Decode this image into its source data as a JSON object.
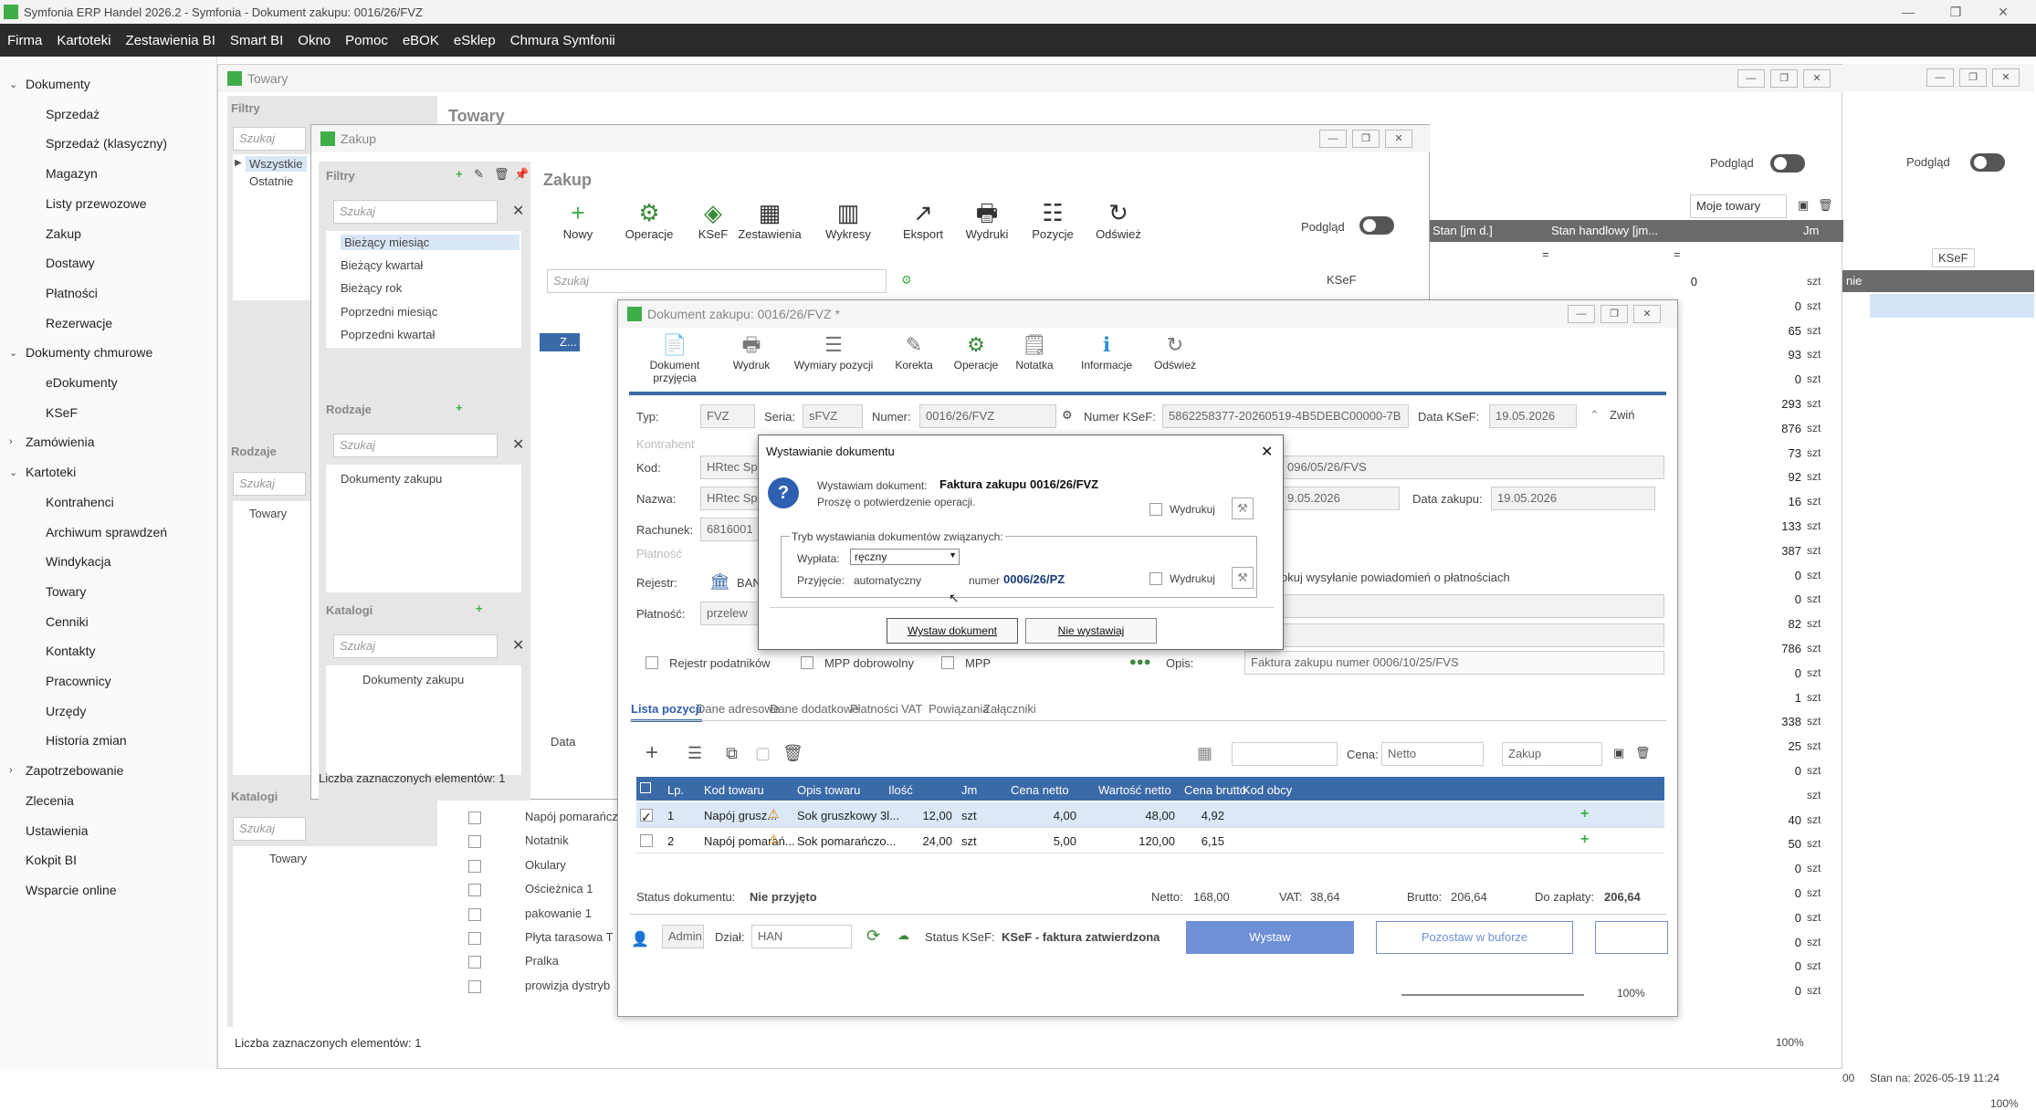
{
  "app": {
    "title": "Symfonia ERP Handel 2026.2 - Symfonia - Dokument zakupu: 0016/26/FVZ"
  },
  "menu": [
    "Firma",
    "Kartoteki",
    "Zestawienia BI",
    "Smart BI",
    "Okno",
    "Pomoc",
    "eBOK",
    "eSklep",
    "Chmura Symfonii"
  ],
  "sidebar": [
    {
      "label": "Dokumenty",
      "level": 0,
      "expanded": true
    },
    {
      "label": "Sprzedaż",
      "level": 1
    },
    {
      "label": "Sprzedaż (klasyczny)",
      "level": 1
    },
    {
      "label": "Magazyn",
      "level": 1
    },
    {
      "label": "Listy przewozowe",
      "level": 1
    },
    {
      "label": "Zakup",
      "level": 1
    },
    {
      "label": "Dostawy",
      "level": 1
    },
    {
      "label": "Płatności",
      "level": 1
    },
    {
      "label": "Rezerwacje",
      "level": 1
    },
    {
      "label": "Dokumenty chmurowe",
      "level": 0,
      "expanded": true
    },
    {
      "label": "eDokumenty",
      "level": 1
    },
    {
      "label": "KSeF",
      "level": 1
    },
    {
      "label": "Zamówienia",
      "level": 0,
      "expanded": false
    },
    {
      "label": "Kartoteki",
      "level": 0,
      "expanded": true
    },
    {
      "label": "Kontrahenci",
      "level": 1
    },
    {
      "label": "Archiwum sprawdzeń",
      "level": 1
    },
    {
      "label": "Windykacja",
      "level": 1
    },
    {
      "label": "Towary",
      "level": 1
    },
    {
      "label": "Cenniki",
      "level": 1
    },
    {
      "label": "Kontakty",
      "level": 1
    },
    {
      "label": "Pracownicy",
      "level": 1
    },
    {
      "label": "Urzędy",
      "level": 1
    },
    {
      "label": "Historia zmian",
      "level": 1
    },
    {
      "label": "Zapotrzebowanie",
      "level": 0,
      "expanded": false
    },
    {
      "label": "Zlecenia",
      "level": 0
    },
    {
      "label": "Ustawienia",
      "level": 0
    },
    {
      "label": "Kokpit BI",
      "level": 0
    },
    {
      "label": "Wsparcie online",
      "level": 0
    }
  ],
  "towary_window": {
    "title": "Towary",
    "heading": "Towary",
    "filters_label": "Filtry",
    "search_placeholder": "Szukaj",
    "filters": [
      "Wszystkie",
      "Ostatnie"
    ],
    "rodzaje_label": "Rodzaje",
    "rodzaje_items": [
      "Towary"
    ],
    "katalogi_label": "Katalogi",
    "katalogi_items": [
      "Towary"
    ],
    "preview_label": "Podgląd",
    "view_select": "Moje towary",
    "col_stan": "Stan [jm d.]",
    "col_handlowy": "Stan handlowy [jm...",
    "col_jm": "Jm",
    "eq": "=",
    "stan_first": "0",
    "stan_handlowy": [
      "0",
      "65",
      "93",
      "0",
      "293",
      "876",
      "73",
      "92",
      "16",
      "133",
      "387",
      "0",
      "0",
      "82",
      "786",
      "0",
      "1",
      "338",
      "25",
      "0",
      "",
      "40",
      "50",
      "0",
      "0",
      "0",
      "0",
      "0",
      "0"
    ],
    "unit": "szt",
    "products": [
      "Napój pomarańcz",
      "Notatnik",
      "Okulary",
      "Ościeżnica 1",
      "pakowanie 1",
      "Płyta tarasowa T",
      "Pralka",
      "prowizja dystryb"
    ],
    "status_count": "Liczba zaznaczonych elementów: 1",
    "zoom": "100%"
  },
  "right_window": {
    "preview_label": "Podgląd",
    "ksef": "KSeF",
    "col": "nie",
    "status": "Stan na: 2026-05-19 11:24",
    "pre": "00",
    "zoom": "100%"
  },
  "zakup_window": {
    "title": "Zakup",
    "heading": "Zakup",
    "filters_label": "Filtry",
    "search_placeholder": "Szukaj",
    "filters": [
      "Bieżący miesiąc",
      "Bieżący kwartał",
      "Bieżący rok",
      "Poprzedni miesiąc",
      "Poprzedni kwartał"
    ],
    "rodzaje_label": "Rodzaje",
    "rodzaje_items": [
      "Dokumenty zakupu"
    ],
    "katalogi_label": "Katalogi",
    "katalogi_items": [
      "Dokumenty zakupu"
    ],
    "toolbar": [
      "Nowy",
      "Operacje",
      "KSeF",
      "Zestawienia",
      "Wykresy",
      "Eksport",
      "Wydruki",
      "Pozycje",
      "Odśwież"
    ],
    "preview_label": "Podgląd",
    "ksef": "KSeF",
    "col_z": "Z...",
    "data_label": "Data",
    "status_count": "Liczba zaznaczonych elementów: 1"
  },
  "doc_window": {
    "title": "Dokument zakupu: 0016/26/FVZ *",
    "toolbar": [
      "Dokument przyjęcia",
      "Wydruk",
      "Wymiary pozycji",
      "Korekta",
      "Operacje",
      "Notatka",
      "Informacje",
      "Odśwież"
    ],
    "typ_label": "Typ:",
    "typ": "FVZ",
    "seria_label": "Seria:",
    "seria": "sFVZ",
    "numer_label": "Numer:",
    "numer": "0016/26/FVZ",
    "numer_ksef_label": "Numer KSeF:",
    "numer_ksef": "5862258377-20260519-4B5DEBC00000-7B",
    "data_ksef_label": "Data KSeF:",
    "data_ksef": "19.05.2026",
    "zwin": "Zwiń",
    "kontrahent_label": "Kontrahent",
    "kod_label": "Kod:",
    "kod": "HRtec Sp",
    "nazwa_label": "Nazwa:",
    "nazwa": "HRtec Sp",
    "rachunek_label": "Rachunek:",
    "rachunek": "6816001",
    "platnosc_section": "Płatność",
    "rejestr_label": "Rejestr:",
    "rejestr": "BAN",
    "platnosc_label": "Płatność:",
    "platnosc": "przelew",
    "doc_obcy": "096/05/26/FVS",
    "data_wyst": "9.05.2026",
    "data_zakupu_label": "Data zakupu:",
    "data_zakupu": "19.05.2026",
    "powiadomienia": "okuj wysyłanie powiadomień o płatnościach",
    "rejestr_podatnikow": "Rejestr podatników",
    "mpp_dobrowolny": "MPP dobrowolny",
    "mpp": "MPP",
    "opis_label": "Opis:",
    "opis": "Faktura zakupu numer 0006/10/25/FVS",
    "tabs": [
      "Lista pozycji",
      "Dane adresowe",
      "Dane dodatkowe",
      "Płatności",
      "VAT",
      "Powiązania",
      "Załączniki"
    ],
    "cena_label": "Cena:",
    "cena": "Netto",
    "cena_typ": "Zakup",
    "columns": [
      "Lp.",
      "Kod towaru",
      "Opis towaru",
      "Ilość",
      "Jm",
      "Cena netto",
      "Wartość netto",
      "Cena brutto",
      "Kod obcy"
    ],
    "rows": [
      {
        "lp": "1",
        "kod": "Napój grusz...",
        "opis": "Sok gruszkowy 3l...",
        "ilosc": "12,00",
        "jm": "szt",
        "cena_netto": "4,00",
        "wartosc": "48,00",
        "brutto": "4,92"
      },
      {
        "lp": "2",
        "kod": "Napój pomarań...",
        "opis": "Sok pomarańczo...",
        "ilosc": "24,00",
        "jm": "szt",
        "cena_netto": "5,00",
        "wartosc": "120,00",
        "brutto": "6,15"
      }
    ],
    "status_label": "Status dokumentu:",
    "status": "Nie przyjęto",
    "netto_label": "Netto:",
    "netto": "168,00",
    "vat_label": "VAT:",
    "vat": "38,64",
    "brutto_label": "Brutto:",
    "brutto": "206,64",
    "zaplaty_label": "Do zapłaty:",
    "zaplaty": "206,64",
    "user": "Admin",
    "dzial_label": "Dział:",
    "dzial": "HAN",
    "ksef_status_label": "Status KSeF:",
    "ksef_status": "KSeF - faktura zatwierdzona",
    "wystaw": "Wystaw",
    "pozostaw": "Pozostaw w buforze",
    "zoom": "100%"
  },
  "dialog": {
    "title": "Wystawianie dokumentu",
    "issuing": "Wystawiam dokument:",
    "doc": "Faktura zakupu 0016/26/FVZ",
    "confirm": "Proszę o potwierdzenie operacji.",
    "wydrukuj": "Wydrukuj",
    "group": "Tryb wystawiania dokumentów związanych:",
    "wyplata_label": "Wypłata:",
    "wyplata": "ręczny",
    "przyjecie_label": "Przyjęcie:",
    "przyjecie": "automatyczny",
    "numer_label": "numer",
    "numer": "0006/26/PZ",
    "btn_ok": "Wystaw dokument",
    "btn_cancel": "Nie wystawiaj"
  },
  "colors": {
    "accent": "#3b6aa8",
    "menubar": "#2b2b2b",
    "brand": "#3fae49"
  }
}
